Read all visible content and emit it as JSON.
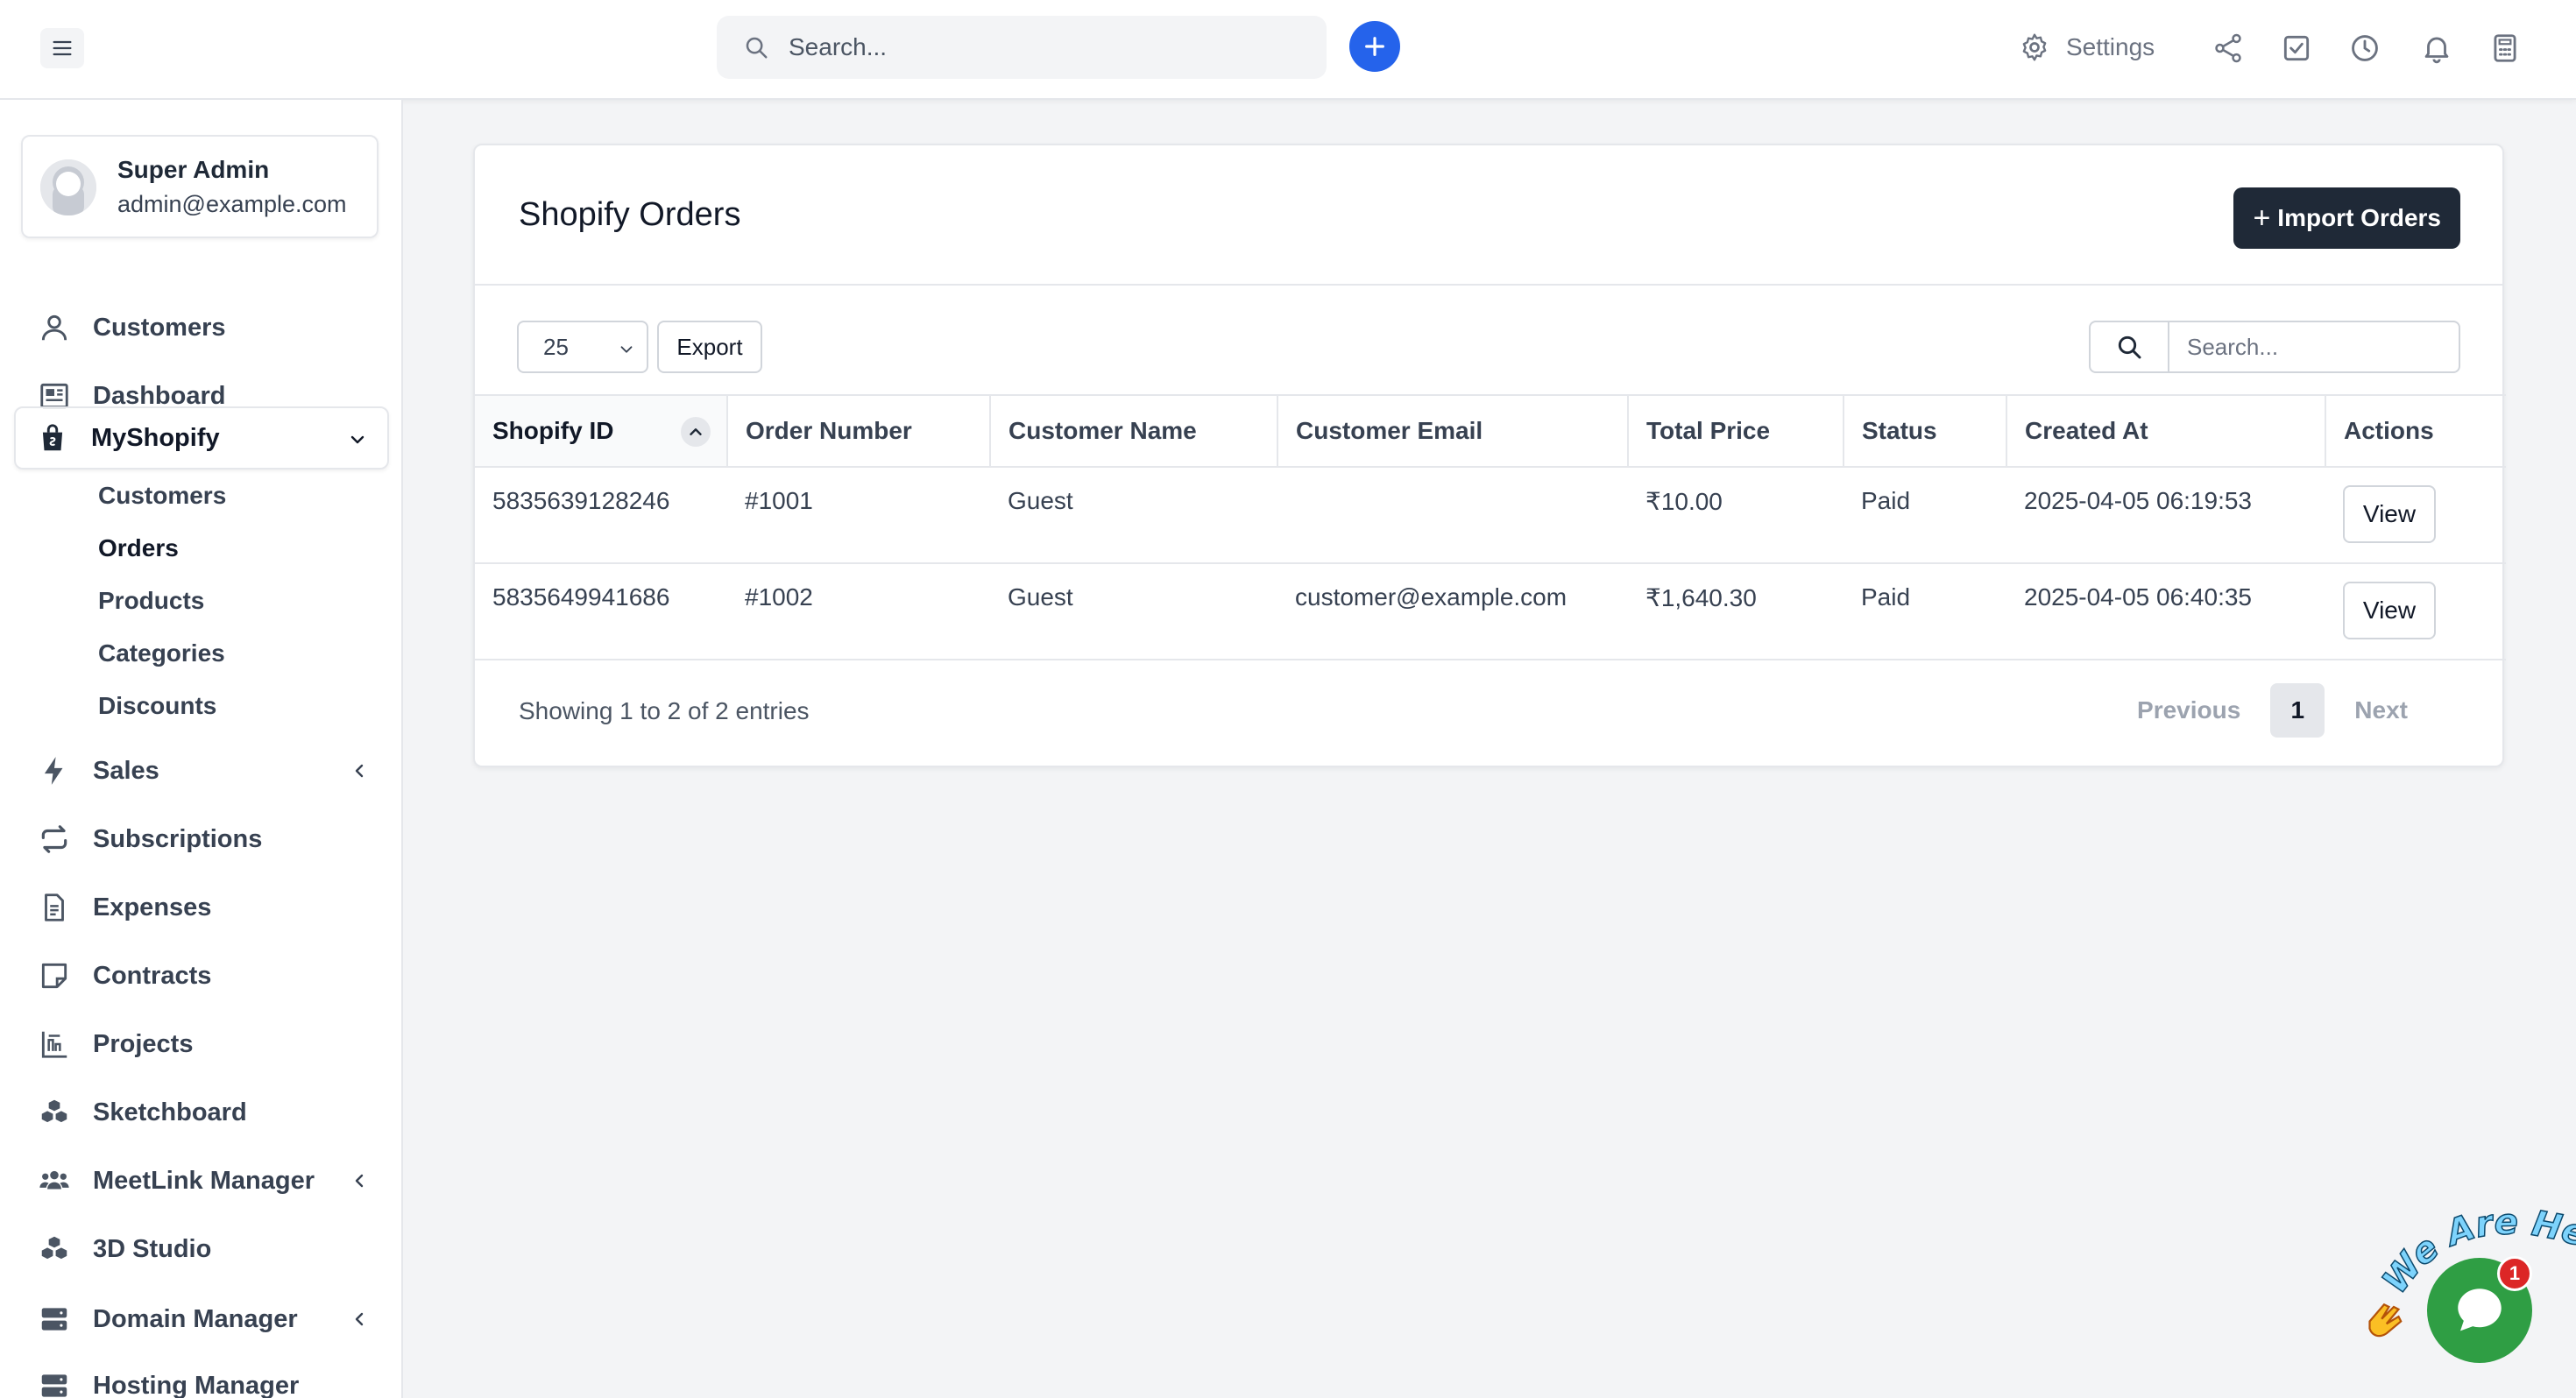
{
  "topbar": {
    "search_placeholder": "Search...",
    "settings_label": "Settings"
  },
  "profile": {
    "name": "Super Admin",
    "email": "admin@example.com"
  },
  "sidebar": {
    "items": [
      {
        "label": "Customers",
        "icon": "user-icon"
      },
      {
        "label": "Dashboard",
        "icon": "dashboard-icon"
      },
      {
        "label": "MyShopify",
        "icon": "shopping-bag-icon"
      },
      {
        "label": "Sales",
        "icon": "bolt-icon"
      },
      {
        "label": "Subscriptions",
        "icon": "repeat-icon"
      },
      {
        "label": "Expenses",
        "icon": "document-icon"
      },
      {
        "label": "Contracts",
        "icon": "sticky-note-icon"
      },
      {
        "label": "Projects",
        "icon": "chart-icon"
      },
      {
        "label": "Sketchboard",
        "icon": "cubes-icon"
      },
      {
        "label": "MeetLink Manager",
        "icon": "users-icon"
      },
      {
        "label": "3D Studio",
        "icon": "cubes-icon"
      },
      {
        "label": "Domain Manager",
        "icon": "server-icon"
      },
      {
        "label": "Hosting Manager",
        "icon": "server-icon"
      }
    ],
    "submenu": [
      "Customers",
      "Orders",
      "Products",
      "Categories",
      "Discounts"
    ]
  },
  "page": {
    "title": "Shopify Orders",
    "import_label": "Import Orders",
    "length_value": "25",
    "export_label": "Export",
    "search_placeholder": "Search...",
    "columns": [
      "Shopify ID",
      "Order Number",
      "Customer Name",
      "Customer Email",
      "Total Price",
      "Status",
      "Created At",
      "Actions"
    ],
    "rows": [
      {
        "id": "5835639128246",
        "order": "#1001",
        "name": "Guest",
        "email": "",
        "price": "₹10.00",
        "status": "Paid",
        "created": "2025-04-05 06:19:53",
        "action": "View"
      },
      {
        "id": "5835649941686",
        "order": "#1002",
        "name": "Guest",
        "email": "customer@example.com",
        "price": "₹1,640.30",
        "status": "Paid",
        "created": "2025-04-05 06:40:35",
        "action": "View"
      }
    ],
    "showing": "Showing 1 to 2 of 2 entries",
    "pager": {
      "previous": "Previous",
      "current": "1",
      "next": "Next"
    }
  },
  "chat": {
    "tagline": "We Are Here!",
    "badge": "1"
  },
  "colors": {
    "accent": "#2563eb",
    "dark_button": "#1f2937",
    "chat_green": "#2f9e44",
    "badge_red": "#dc2626"
  }
}
